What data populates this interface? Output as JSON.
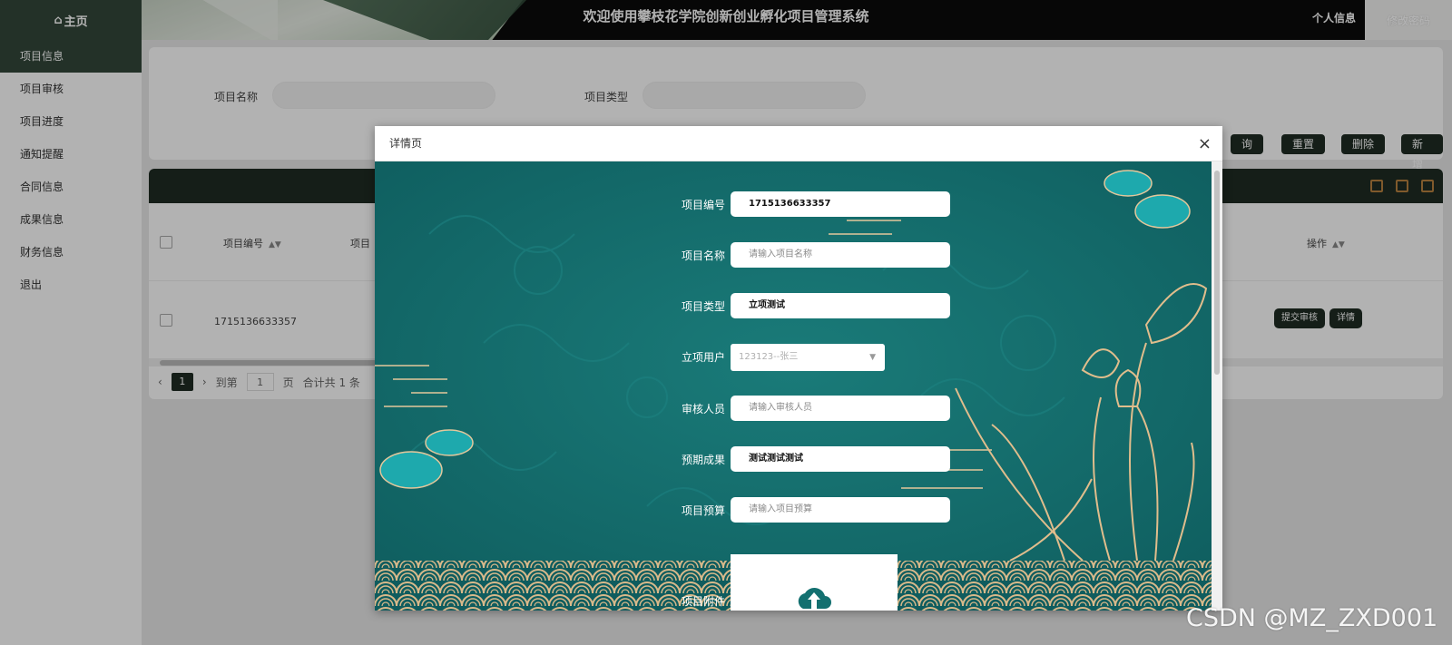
{
  "header": {
    "home_label": "主页",
    "title": "欢迎使用攀枝花学院创新创业孵化项目管理系统",
    "profile_label": "个人信息",
    "change_password_label": "修改密码"
  },
  "sidebar": {
    "items": [
      {
        "label": "项目信息"
      },
      {
        "label": "项目审核"
      },
      {
        "label": "项目进度"
      },
      {
        "label": "通知提醒"
      },
      {
        "label": "合同信息"
      },
      {
        "label": "成果信息"
      },
      {
        "label": "财务信息"
      },
      {
        "label": "退出"
      }
    ]
  },
  "search": {
    "name_label": "项目名称",
    "type_label": "项目类型",
    "query_label": "询",
    "reset_label": "重置",
    "delete_label": "删除",
    "add_label": "新增"
  },
  "table": {
    "columns": {
      "code": "项目编号",
      "name": "项目",
      "action": "操作"
    },
    "rows": [
      {
        "code": "1715136633357",
        "submit_label": "提交审核",
        "detail_label": "详情"
      }
    ],
    "pagination": {
      "current_page": "1",
      "goto_label": "到第",
      "goto_value": "1",
      "page_unit": "页",
      "total_label": "合计共 1 条"
    }
  },
  "dialog": {
    "title": "详情页",
    "close_icon": "close-icon",
    "fields": {
      "code": {
        "label": "项目编号",
        "value": "1715136633357"
      },
      "name": {
        "label": "项目名称",
        "placeholder": "请输入项目名称"
      },
      "type": {
        "label": "项目类型",
        "value": "立项测试"
      },
      "user": {
        "label": "立项用户",
        "value": "123123--张三"
      },
      "reviewer": {
        "label": "审核人员",
        "placeholder": "请输入审核人员"
      },
      "result": {
        "label": "预期成果",
        "value": "测试测试测试"
      },
      "budget": {
        "label": "项目预算",
        "placeholder": "请输入项目预算"
      },
      "attachment": {
        "label": "项目附件"
      }
    }
  },
  "watermark": "CSDN @MZ_ZXD001",
  "colors": {
    "accent": "#33473a",
    "dark_button": "#1f2c23",
    "dialog_background": "#137070",
    "gold": "#d9b98a"
  }
}
